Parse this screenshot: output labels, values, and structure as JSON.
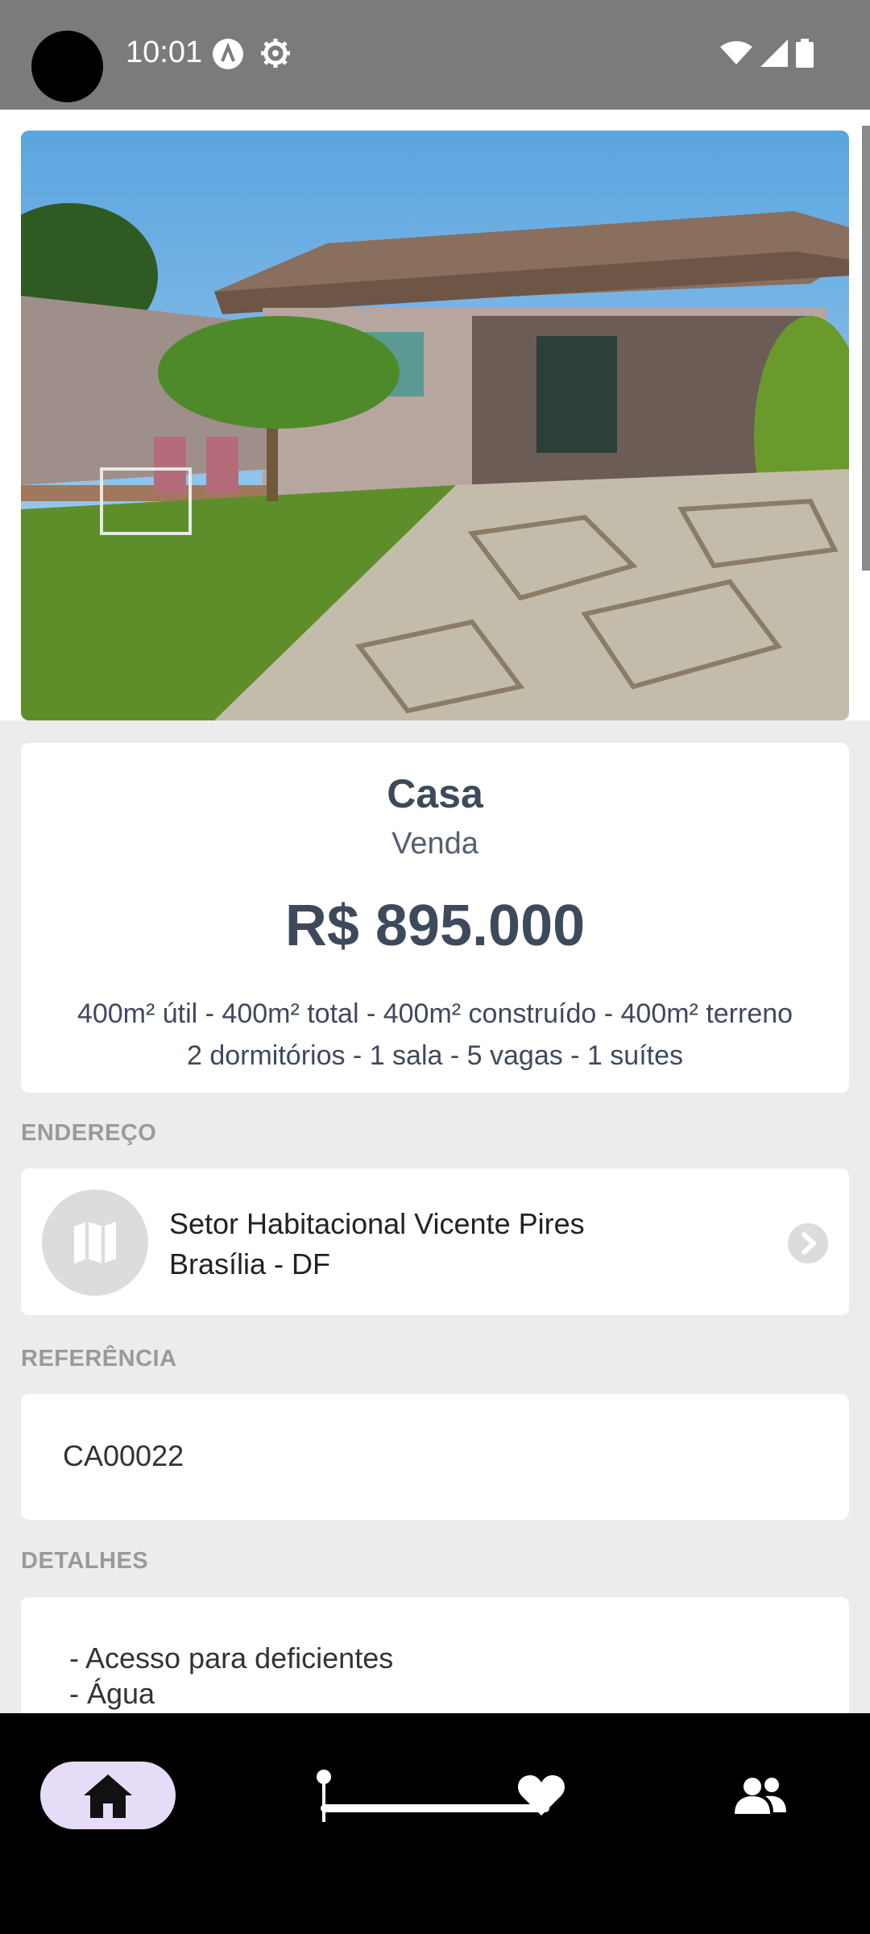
{
  "status_bar": {
    "time": "10:01"
  },
  "listing": {
    "title": "Casa",
    "subtitle": "Venda",
    "price": "R$ 895.000",
    "specs_line1": "400m² útil - 400m² total - 400m² construído - 400m² terreno",
    "specs_line2": "2 dormitórios - 1 sala - 5 vagas - 1 suítes"
  },
  "address": {
    "label": "ENDEREÇO",
    "line1": "Setor Habitacional Vicente Pires",
    "line2": "Brasília - DF"
  },
  "reference": {
    "label": "REFERÊNCIA",
    "code": "CA00022"
  },
  "details": {
    "label": "DETALHES",
    "items": [
      "- Acesso para deficientes",
      "- Água"
    ]
  },
  "nav": {
    "items": [
      "home-icon",
      "pin-icon",
      "heart-icon",
      "people-icon"
    ],
    "active": "home-icon"
  },
  "colors": {
    "status_bar": "#7b7b7b",
    "accent_nav": "#e6dcf7",
    "text_primary": "#3e4a5c",
    "background": "#ececec"
  }
}
